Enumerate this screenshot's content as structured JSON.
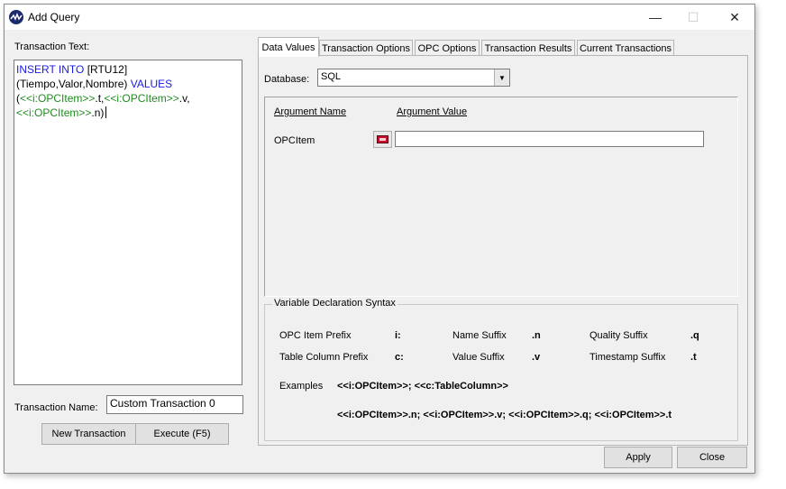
{
  "window": {
    "title": "Add Query",
    "minimize": "—",
    "maximize": "☐",
    "close": "✕"
  },
  "left": {
    "transaction_text_label": "Transaction Text:",
    "sql": {
      "l1_kw": "INSERT INTO",
      "l1_rest": " [RTU12]",
      "l2_rest": "(Tiempo,Valor,Nombre) ",
      "l2_kw": "VALUES",
      "l3_a": "(",
      "l3_v1": "<<i:OPCItem>>",
      "l3_b": ".t,",
      "l3_v2": "<<i:OPCItem>>",
      "l3_c": ".v,",
      "l4_v": "<<i:OPCItem>>",
      "l4_b": ".n)"
    },
    "transaction_name_label": "Transaction Name:",
    "transaction_name_value": "Custom Transaction 0",
    "new_transaction_button": "New Transaction",
    "execute_button": "Execute (F5)"
  },
  "tabs": [
    {
      "label": "Data Values"
    },
    {
      "label": "Transaction Options"
    },
    {
      "label": "OPC Options"
    },
    {
      "label": "Transaction Results"
    },
    {
      "label": "Current Transactions"
    }
  ],
  "data_values": {
    "database_label": "Database:",
    "database_value": "SQL",
    "arg_name_header": "Argument Name",
    "arg_value_header": "Argument Value",
    "args": [
      {
        "name": "OPCItem",
        "value": ""
      }
    ]
  },
  "syntax": {
    "title": "Variable Declaration Syntax",
    "opc_item_prefix_label": "OPC Item Prefix",
    "opc_item_prefix_value": "i:",
    "table_column_prefix_label": "Table Column Prefix",
    "table_column_prefix_value": "c:",
    "name_suffix_label": "Name Suffix",
    "name_suffix_value": ".n",
    "value_suffix_label": "Value Suffix",
    "value_suffix_value": ".v",
    "quality_suffix_label": "Quality Suffix",
    "quality_suffix_value": ".q",
    "timestamp_suffix_label": "Timestamp Suffix",
    "timestamp_suffix_value": ".t",
    "examples_label": "Examples",
    "examples_line1": "<<i:OPCItem>>; <<c:TableColumn>>",
    "examples_line2": "<<i:OPCItem>>.n; <<i:OPCItem>>.v; <<i:OPCItem>>.q; <<i:OPCItem>>.t"
  },
  "footer": {
    "apply_button": "Apply",
    "close_button": "Close"
  }
}
